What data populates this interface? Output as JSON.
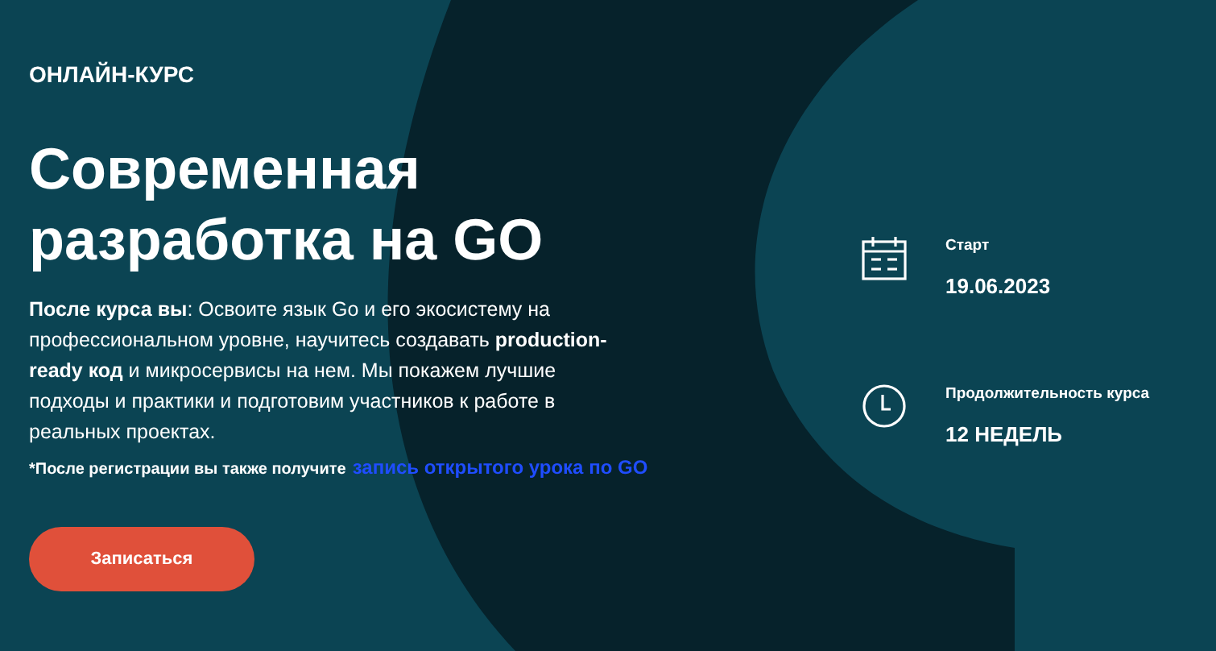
{
  "eyebrow": "ОНЛАЙН-КУРС",
  "title": "Современная разработка на GO",
  "description": "**После курса вы**: Освоите язык Go и его экосистему на профессиональном уровне, научитесь создавать **production-ready код** и микросервисы на нем. Мы покажем лучшие подходы и практики и подготовим участников к работе в реальных проектах.",
  "note": "*После регистрации вы также получите",
  "note_link": "запись открытого урока по GO",
  "button": "Записаться",
  "facts": [
    {
      "kind": "calendar",
      "label": "Старт",
      "value": "19.06.2023"
    },
    {
      "kind": "clock",
      "label": "Продолжительность курса",
      "value": "12 НЕДЕЛЬ"
    }
  ]
}
